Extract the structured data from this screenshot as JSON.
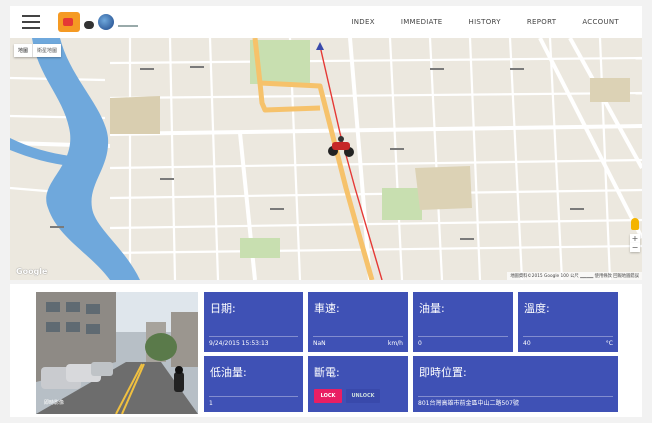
{
  "nav": {
    "items": [
      "INDEX",
      "IMMEDIATE",
      "HISTORY",
      "REPORT",
      "ACCOUNT"
    ]
  },
  "map": {
    "type_buttons": [
      "地圖",
      "衛星地圖"
    ],
    "google_label": "Google",
    "footer": "地圖資料©2015 Google   100 公尺 ▁▁▁▁  使用條款  回報地圖錯誤"
  },
  "street_view": {
    "caption": "即時影像"
  },
  "cards": {
    "date": {
      "title": "日期:",
      "value": "9/24/2015 15:53:13"
    },
    "speed": {
      "title": "車速:",
      "value": "NaN",
      "unit": "km/h"
    },
    "fuel": {
      "title": "油量:",
      "value": "0"
    },
    "temp": {
      "title": "溫度:",
      "value": "40",
      "unit": "°C"
    },
    "low_fuel": {
      "title": "低油量:",
      "value": "1"
    },
    "power_cut": {
      "title": "斷電:",
      "lock_label": "LOCK",
      "unlock_label": "UNLOCK"
    },
    "location": {
      "title": "即時位置:",
      "value": "801台灣高雄市前金區中山二路507號"
    }
  },
  "colors": {
    "card_bg": "#3f51b5",
    "lock_btn": "#e91e63",
    "route_line": "#e53935",
    "main_road": "#f6c26b",
    "river": "#6fa8dc"
  }
}
